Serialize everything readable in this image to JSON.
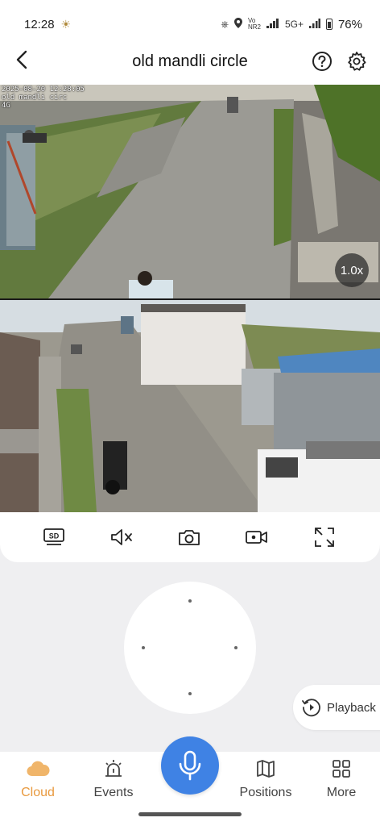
{
  "status_bar": {
    "time": "12:28",
    "network": "5G+",
    "battery": "76%"
  },
  "header": {
    "title": "old mandli circle"
  },
  "video": {
    "osd_timestamp": "2025-08-20 12:28:05",
    "osd_name": "old mandli circ",
    "osd_network": "4G",
    "zoom": "1.0x"
  },
  "toolbar": {
    "quality_label": "SD"
  },
  "playback": {
    "label": "Playback"
  },
  "nav": {
    "items": [
      {
        "label": "Cloud",
        "icon": "cloud-icon",
        "active": true
      },
      {
        "label": "Events",
        "icon": "alarm-icon",
        "active": false
      },
      {
        "label": "Positions",
        "icon": "map-icon",
        "active": false
      },
      {
        "label": "More",
        "icon": "grid-icon",
        "active": false
      }
    ],
    "mic_icon": "microphone-icon"
  },
  "colors": {
    "accent_blue": "#3f82e4",
    "active_orange": "#e8993e",
    "background": "#efeff1"
  }
}
